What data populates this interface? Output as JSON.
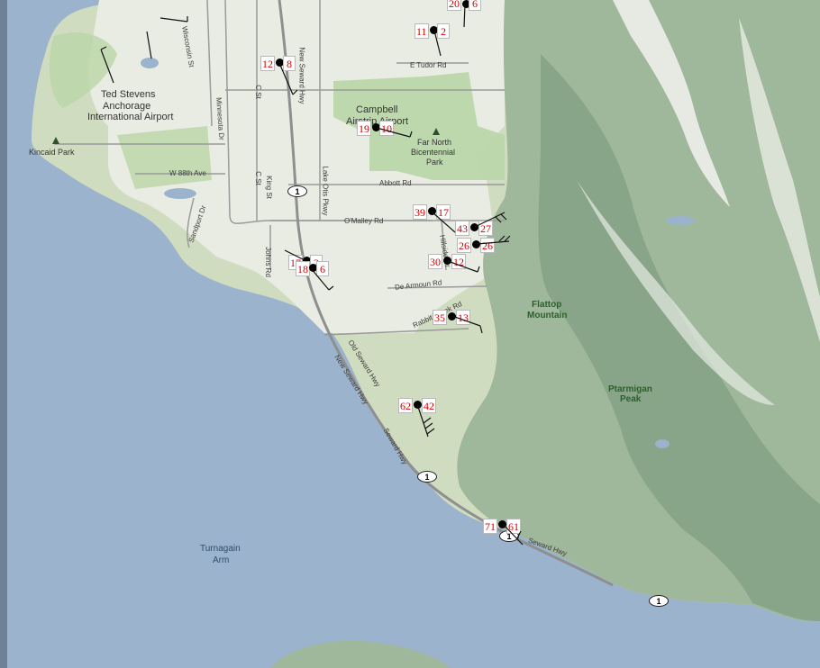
{
  "map": {
    "colors": {
      "water": "#9bb3cc",
      "land": "#cfdcbf",
      "urban": "#e9ece2",
      "park": "#b9d6a8",
      "mountain": "#9fb79a",
      "ridge": "#f3f3f0",
      "road": "#9a9a9a",
      "highway": "#8f8f8f",
      "station_text": "#d40000"
    },
    "places": [
      {
        "text": "Ted Stevens"
      },
      {
        "text": "Anchorage"
      },
      {
        "text": "International Airport"
      },
      {
        "text": "Kincaid Park"
      },
      {
        "text": "Campbell"
      },
      {
        "text": "Airstrip Airport"
      },
      {
        "text": "Far North"
      },
      {
        "text": "Bicentennial"
      },
      {
        "text": "Park"
      },
      {
        "text": "Flattop"
      },
      {
        "text": "Mountain"
      },
      {
        "text": "Ptarmigan"
      },
      {
        "text": "Peak"
      },
      {
        "text": "Turnagain"
      },
      {
        "text": "Arm"
      }
    ],
    "roads": [
      {
        "text": "Wisconsin St"
      },
      {
        "text": "Minnesota Dr"
      },
      {
        "text": "C St"
      },
      {
        "text": "C St"
      },
      {
        "text": "King St"
      },
      {
        "text": "New Seward Hwy"
      },
      {
        "text": "E Tudor Rd"
      },
      {
        "text": "W 88th Ave"
      },
      {
        "text": "Abbott Rd"
      },
      {
        "text": "O'Malley Rd"
      },
      {
        "text": "Lake Otis Pkwy"
      },
      {
        "text": "Johns Rd"
      },
      {
        "text": "Sandport Dr"
      },
      {
        "text": "De Armoun Rd"
      },
      {
        "text": "Rabbit Creek Rd"
      },
      {
        "text": "Hillside Dr"
      },
      {
        "text": "Old Seward Hwy"
      },
      {
        "text": "New Seward Hwy"
      },
      {
        "text": "Seward Hwy"
      },
      {
        "text": "Seward Hwy"
      }
    ],
    "shields": [
      {
        "text": "1"
      },
      {
        "text": "1"
      },
      {
        "text": "1"
      },
      {
        "text": "1"
      }
    ],
    "stations": [
      {
        "a": "20",
        "b": "6"
      },
      {
        "a": "11",
        "b": "2"
      },
      {
        "a": "12",
        "b": "8"
      },
      {
        "a": "19",
        "b": "10"
      },
      {
        "a": "39",
        "b": "17"
      },
      {
        "a": "43",
        "b": "27"
      },
      {
        "a": "26",
        "b": "26"
      },
      {
        "a": "30",
        "b": "12"
      },
      {
        "a": "17",
        "b": "2"
      },
      {
        "a": "18",
        "b": "6"
      },
      {
        "a": "35",
        "b": "13"
      },
      {
        "a": "62",
        "b": "42"
      },
      {
        "a": "71",
        "b": "61"
      }
    ]
  }
}
